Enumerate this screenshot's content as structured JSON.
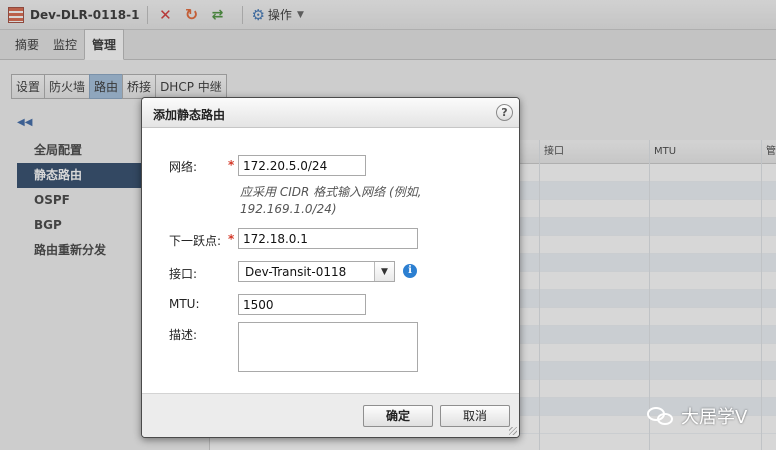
{
  "window": {
    "title": "Dev-DLR-0118-1",
    "actions_label": "操作"
  },
  "tabs": [
    {
      "label": "摘要",
      "active": false
    },
    {
      "label": "监控",
      "active": false
    },
    {
      "label": "管理",
      "active": true
    }
  ],
  "subtabs": [
    {
      "label": "设置",
      "active": false
    },
    {
      "label": "防火墙",
      "active": false
    },
    {
      "label": "路由",
      "active": true
    },
    {
      "label": "桥接",
      "active": false
    },
    {
      "label": "DHCP 中继",
      "active": false
    }
  ],
  "leftnav": [
    {
      "label": "全局配置",
      "active": false
    },
    {
      "label": "静态路由",
      "active": true
    },
    {
      "label": "OSPF",
      "active": false
    },
    {
      "label": "BGP",
      "active": false
    },
    {
      "label": "路由重新分发",
      "active": false
    }
  ],
  "table": {
    "columns": [
      "接口",
      "MTU",
      "管理"
    ]
  },
  "dialog": {
    "title": "添加静态路由",
    "network_label": "网络:",
    "network_value": "172.20.5.0/24",
    "network_hint": "应采用 CIDR 格式输入网络 (例如, 192.169.1.0/24)",
    "nexthop_label": "下一跃点:",
    "nexthop_value": "172.18.0.1",
    "interface_label": "接口:",
    "interface_value": "Dev-Transit-0118",
    "mtu_label": "MTU:",
    "mtu_value": "1500",
    "desc_label": "描述:",
    "desc_value": "",
    "ok_label": "确定",
    "cancel_label": "取消"
  },
  "watermark": {
    "text": "大居学V"
  },
  "colors": {
    "selected_nav": "#1d3a5e",
    "selected_subtab": "#9cbcdc",
    "required": "#d43a2a",
    "info": "#2c7fd1"
  }
}
